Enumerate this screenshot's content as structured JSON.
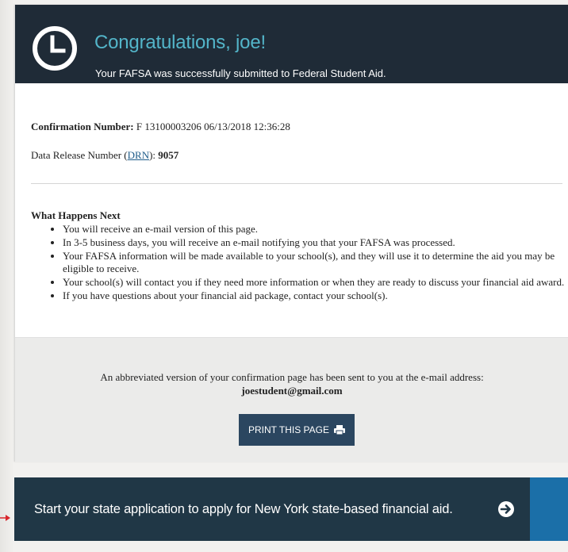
{
  "header": {
    "title": "Congratulations, joe!",
    "subtitle": "Your FAFSA was successfully submitted to Federal Student Aid."
  },
  "confirmation": {
    "label": "Confirmation Number:",
    "value": "F 13100003206 06/13/2018 12:36:28"
  },
  "drn": {
    "label_before": "Data Release Number (",
    "link": "DRN",
    "label_after": "):",
    "value": "9057"
  },
  "next_steps": {
    "title": "What Happens Next",
    "items": [
      "You will receive an e-mail version of this page.",
      "In 3-5 business days, you will receive an e-mail notifying you that your FAFSA was processed.",
      "Your FAFSA information will be made available to your school(s), and they will use it to determine the aid you may be eligible to receive.",
      "Your school(s) will contact you if they need more information or when they are ready to discuss your financial aid award.",
      "If you have questions about your financial aid package, contact your school(s)."
    ]
  },
  "email_notice": {
    "text": "An abbreviated version of your confirmation page has been sent to you at the e-mail address:",
    "email": "joestudent@gmail.com"
  },
  "print_button": {
    "label": "PRINT THIS PAGE"
  },
  "state_banner": {
    "text": "Start your state application to apply for New York state-based financial aid."
  },
  "icons": {
    "clock": "clock-icon",
    "printer": "printer-icon",
    "arrow": "arrow-right-circle-icon"
  },
  "colors": {
    "header_bg": "#1f2b37",
    "title": "#53b5c9",
    "button": "#2b4660",
    "banner": "#203746",
    "banner_side": "#1b6fa8",
    "annotation_arrow": "#d8262c"
  }
}
